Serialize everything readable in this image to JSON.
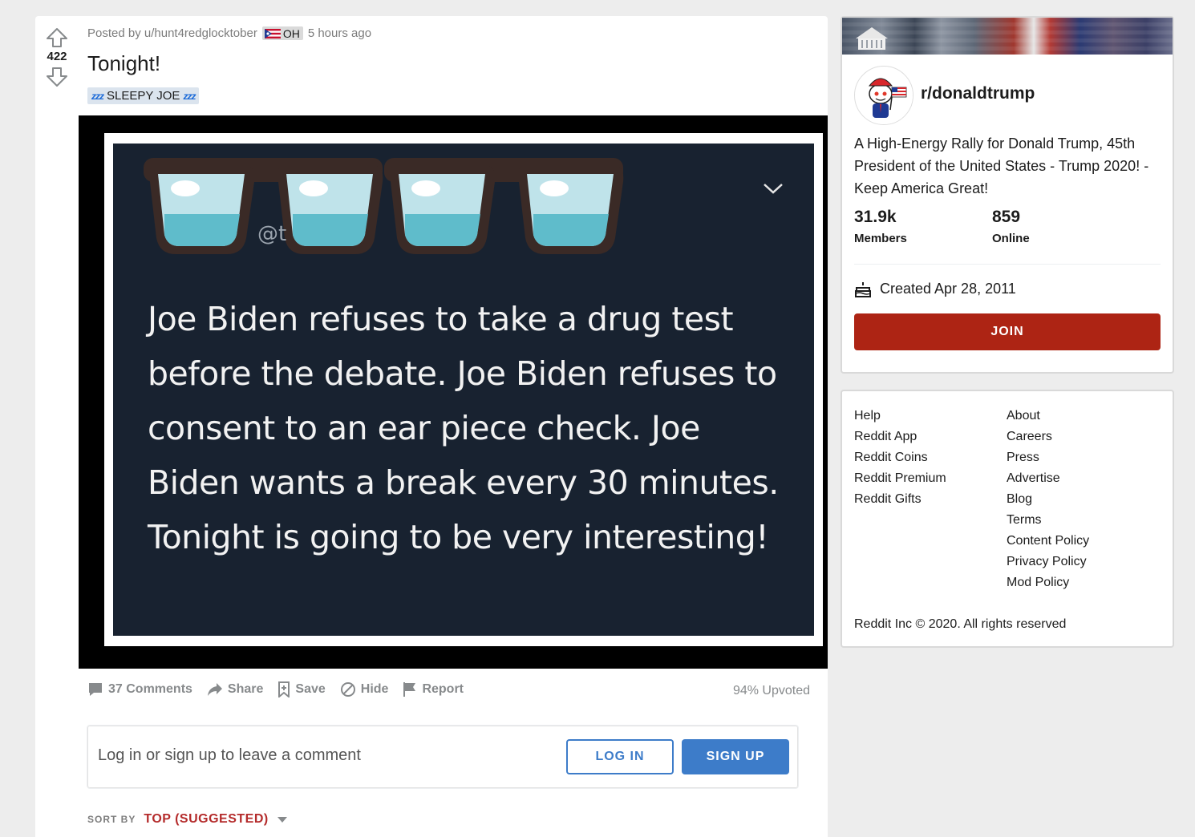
{
  "post": {
    "score": "422",
    "posted_by": "Posted by u/hunt4redglocktober",
    "user_flair": "OH",
    "time": "5 hours ago",
    "title": "Tonight!",
    "post_flair": "SLEEPY JOE",
    "flair_icon": "zzz",
    "image": {
      "handle": "@t",
      "text": "Joe Biden refuses to take a drug test before the debate. Joe Biden refuses to consent to an ear piece check. Joe Biden wants a break every 30 minutes. Tonight is going to be very interesting!"
    },
    "actions": {
      "comments": "37 Comments",
      "share": "Share",
      "save": "Save",
      "hide": "Hide",
      "report": "Report"
    },
    "upvoted": "94% Upvoted"
  },
  "comment_box": {
    "prompt": "Log in or sign up to leave a comment",
    "login": "LOG IN",
    "signup": "SIGN UP"
  },
  "sort": {
    "label": "SORT BY",
    "value": "TOP (SUGGESTED)"
  },
  "sidebar": {
    "subreddit": "r/donaldtrump",
    "description": "A High-Energy Rally for Donald Trump, 45th President of the United States - Trump 2020! - Keep America Great!",
    "members_count": "31.9k",
    "members_label": "Members",
    "online_count": "859",
    "online_label": "Online",
    "created": "Created Apr 28, 2011",
    "join": "JOIN"
  },
  "footer": {
    "col1": [
      "Help",
      "Reddit App",
      "Reddit Coins",
      "Reddit Premium",
      "Reddit Gifts"
    ],
    "col2": [
      "About",
      "Careers",
      "Press",
      "Advertise",
      "Blog",
      "Terms",
      "Content Policy",
      "Privacy Policy",
      "Mod Policy"
    ],
    "copyright": "Reddit Inc © 2020. All rights reserved"
  },
  "colors": {
    "accent_blue": "#3d7cc9",
    "join_red": "#ad2414",
    "sort_red": "#b42b2b",
    "image_bg": "#182230"
  }
}
